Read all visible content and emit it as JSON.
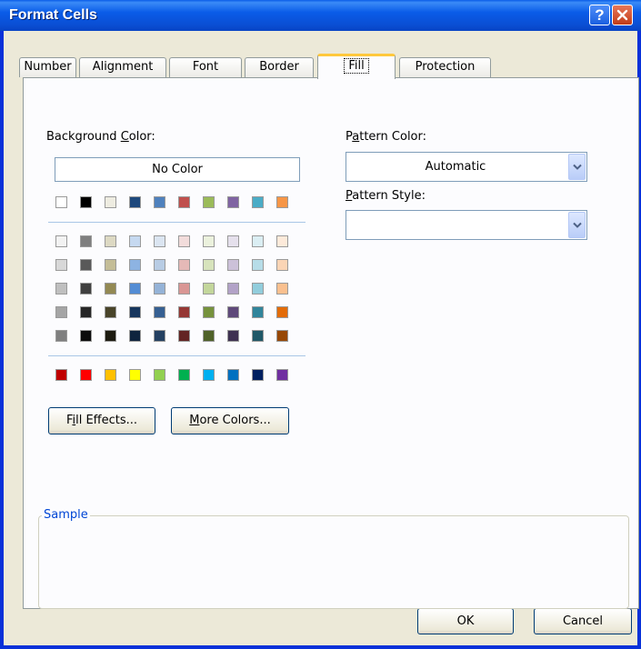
{
  "window": {
    "title": "Format Cells"
  },
  "tabs": [
    {
      "label": "Number"
    },
    {
      "label": "Alignment"
    },
    {
      "label": "Font"
    },
    {
      "label": "Border"
    },
    {
      "label": "Fill",
      "active": true
    },
    {
      "label": "Protection"
    }
  ],
  "background_color": {
    "label_pre": "Background ",
    "label_u": "C",
    "label_post": "olor:",
    "no_color": "No Color",
    "theme_row": [
      "#ffffff",
      "#000000",
      "#eeece1",
      "#1f497d",
      "#4f81bd",
      "#c0504d",
      "#9bbb59",
      "#8064a2",
      "#4bacc6",
      "#f79646"
    ],
    "tints": [
      [
        "#f2f2f2",
        "#7f7f7f",
        "#ddd9c3",
        "#c6d9f0",
        "#dbe5f1",
        "#f2dcdb",
        "#ebf1dd",
        "#e5e0ec",
        "#dbeef3",
        "#fdeada"
      ],
      [
        "#d8d8d8",
        "#595959",
        "#c4bd97",
        "#8db3e2",
        "#b8cce4",
        "#e5b9b7",
        "#d7e3bc",
        "#ccc1d9",
        "#b7dde8",
        "#fbd5b5"
      ],
      [
        "#bfbfbf",
        "#3f3f3f",
        "#938953",
        "#548dd4",
        "#95b3d7",
        "#d99694",
        "#c3d69b",
        "#b2a2c7",
        "#92cddc",
        "#fac08f"
      ],
      [
        "#a5a5a5",
        "#262626",
        "#494429",
        "#17365d",
        "#366092",
        "#953734",
        "#76923c",
        "#5f497a",
        "#31859b",
        "#e36c09"
      ],
      [
        "#7f7f7f",
        "#0c0c0c",
        "#1d1b10",
        "#0f243e",
        "#244061",
        "#632423",
        "#4f6128",
        "#3f3151",
        "#205867",
        "#974806"
      ]
    ],
    "standard_row": [
      "#c00000",
      "#ff0000",
      "#ffc000",
      "#ffff00",
      "#92d050",
      "#00b050",
      "#00b0f0",
      "#0070c0",
      "#002060",
      "#7030a0"
    ]
  },
  "buttons": {
    "fill_effects_pre": "F",
    "fill_effects_u": "i",
    "fill_effects_post": "ll Effects...",
    "more_colors_pre": "",
    "more_colors_u": "M",
    "more_colors_post": "ore Colors...",
    "ok": "OK",
    "cancel": "Cancel"
  },
  "pattern_color": {
    "label_pre": "P",
    "label_u": "a",
    "label_post": "ttern Color:",
    "value": "Automatic"
  },
  "pattern_style": {
    "label_pre": "",
    "label_u": "P",
    "label_post": "attern Style:",
    "value": ""
  },
  "sample": {
    "label": "Sample"
  },
  "colors": {
    "title_bar": "#0a5ce8",
    "dialog_bg": "#ece9d8",
    "panel_bg": "#fcfcfe",
    "active_tab_highlight": "#ffc83c",
    "group_title": "#0046d5"
  }
}
